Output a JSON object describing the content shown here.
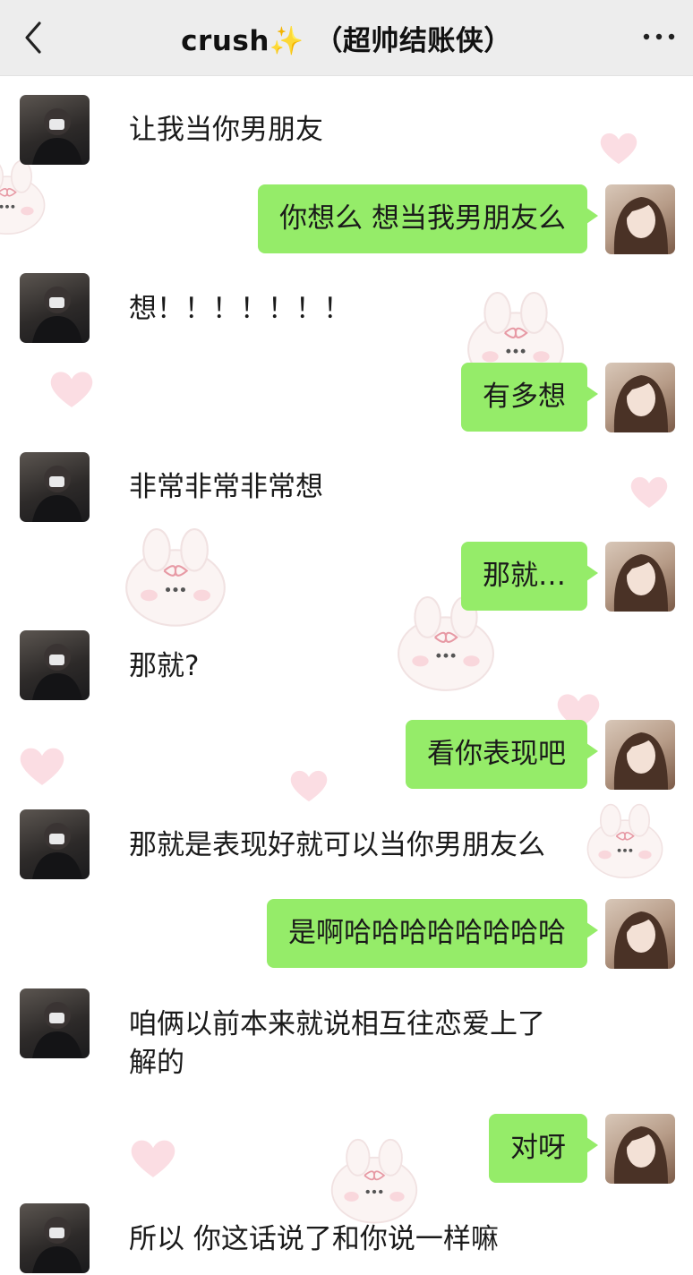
{
  "header": {
    "title": "crush",
    "sparkle": "✨",
    "subtitle": "（超帅结账侠）"
  },
  "messages": [
    {
      "side": "left",
      "text": "让我当你男朋友"
    },
    {
      "side": "right",
      "text": "你想么 想当我男朋友么"
    },
    {
      "side": "left",
      "text": "想！！！！！！！"
    },
    {
      "side": "right",
      "text": "有多想"
    },
    {
      "side": "left",
      "text": "非常非常非常想"
    },
    {
      "side": "right",
      "text": "那就…"
    },
    {
      "side": "left",
      "text": "那就?"
    },
    {
      "side": "right",
      "text": "看你表现吧"
    },
    {
      "side": "left",
      "text": "那就是表现好就可以当你男朋友么"
    },
    {
      "side": "right",
      "text": "是啊哈哈哈哈哈哈哈哈"
    },
    {
      "side": "left",
      "text_line1": "咱俩以前本来就说相互往恋爱上了",
      "text_line2": "解的"
    },
    {
      "side": "right",
      "text": "对呀"
    },
    {
      "side": "left",
      "text": "所以 你这话说了和你说一样嘛"
    }
  ],
  "colors": {
    "header_bg": "#ededed",
    "self_bubble": "#95ec69",
    "chat_bg": "#ffffff"
  }
}
